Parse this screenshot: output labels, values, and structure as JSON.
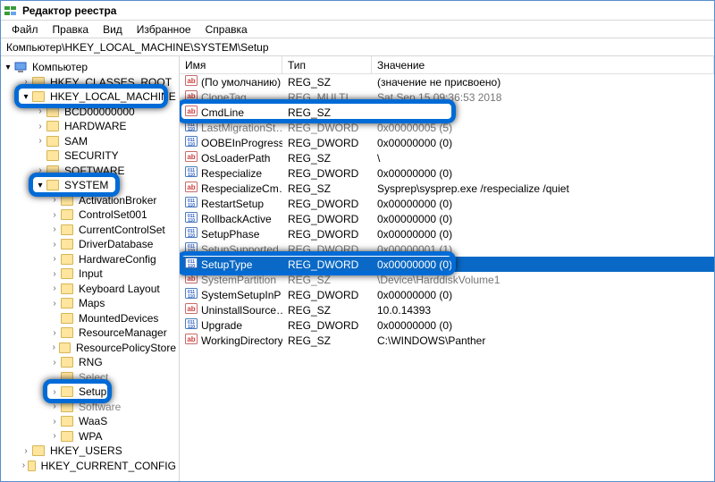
{
  "title": "Редактор реестра",
  "menu": [
    "Файл",
    "Правка",
    "Вид",
    "Избранное",
    "Справка"
  ],
  "path": "Компьютер\\HKEY_LOCAL_MACHINE\\SYSTEM\\Setup",
  "columns": {
    "name": "Имя",
    "type": "Тип",
    "value": "Значение"
  },
  "tree": {
    "root": {
      "label": "Компьютер",
      "kind": "pc",
      "expanded": true
    },
    "nodes": [
      {
        "label": "HKEY_CLASSES_ROOT",
        "depth": 1,
        "exp": "closed"
      },
      {
        "label": "HKEY_LOCAL_MACHINE",
        "depth": 1,
        "exp": "open",
        "hl": true,
        "hl_w": 172,
        "hl_h": 27
      },
      {
        "label": "BCD00000000",
        "depth": 2,
        "exp": "closed"
      },
      {
        "label": "HARDWARE",
        "depth": 2,
        "exp": "closed"
      },
      {
        "label": "SAM",
        "depth": 2,
        "exp": "closed"
      },
      {
        "label": "SECURITY",
        "depth": 2,
        "exp": "none"
      },
      {
        "label": "SOFTWARE",
        "depth": 2,
        "exp": "closed"
      },
      {
        "label": "SYSTEM",
        "depth": 2,
        "exp": "open",
        "hl": true,
        "hl_w": 102,
        "hl_h": 27
      },
      {
        "label": "ActivationBroker",
        "depth": 3,
        "exp": "closed"
      },
      {
        "label": "ControlSet001",
        "depth": 3,
        "exp": "closed"
      },
      {
        "label": "CurrentControlSet",
        "depth": 3,
        "exp": "closed"
      },
      {
        "label": "DriverDatabase",
        "depth": 3,
        "exp": "closed"
      },
      {
        "label": "HardwareConfig",
        "depth": 3,
        "exp": "closed"
      },
      {
        "label": "Input",
        "depth": 3,
        "exp": "closed"
      },
      {
        "label": "Keyboard Layout",
        "depth": 3,
        "exp": "closed"
      },
      {
        "label": "Maps",
        "depth": 3,
        "exp": "closed"
      },
      {
        "label": "MountedDevices",
        "depth": 3,
        "exp": "none"
      },
      {
        "label": "ResourceManager",
        "depth": 3,
        "exp": "closed"
      },
      {
        "label": "ResourcePolicyStore",
        "depth": 3,
        "exp": "closed"
      },
      {
        "label": "RNG",
        "depth": 3,
        "exp": "closed"
      },
      {
        "label": "Select",
        "depth": 3,
        "exp": "none",
        "obscured": true
      },
      {
        "label": "Setup",
        "depth": 3,
        "exp": "closed",
        "hl": true,
        "hl_w": 77,
        "hl_h": 27
      },
      {
        "label": "Software",
        "depth": 3,
        "exp": "closed",
        "obscured": true
      },
      {
        "label": "WaaS",
        "depth": 3,
        "exp": "closed"
      },
      {
        "label": "WPA",
        "depth": 3,
        "exp": "closed"
      },
      {
        "label": "HKEY_USERS",
        "depth": 1,
        "exp": "closed"
      },
      {
        "label": "HKEY_CURRENT_CONFIG",
        "depth": 1,
        "exp": "closed"
      }
    ]
  },
  "rows": [
    {
      "name": "(По умолчанию)",
      "type": "REG_SZ",
      "value": "(значение не присвоено)",
      "icon": "str"
    },
    {
      "name": "CloneTag",
      "type": "REG_MULTI_SZ",
      "value": "Sat Sep 15 09:36:53 2018",
      "icon": "str",
      "obscured": true
    },
    {
      "name": "CmdLine",
      "type": "REG_SZ",
      "value": "",
      "icon": "str",
      "hl": true
    },
    {
      "name": "LastMigrationSt…",
      "type": "REG_DWORD",
      "value": "0x00000005 (5)",
      "icon": "bin",
      "obscured": true
    },
    {
      "name": "OOBEInProgress",
      "type": "REG_DWORD",
      "value": "0x00000000 (0)",
      "icon": "bin"
    },
    {
      "name": "OsLoaderPath",
      "type": "REG_SZ",
      "value": "\\",
      "icon": "str"
    },
    {
      "name": "Respecialize",
      "type": "REG_DWORD",
      "value": "0x00000000 (0)",
      "icon": "bin"
    },
    {
      "name": "RespecializeCm…",
      "type": "REG_SZ",
      "value": "Sysprep\\sysprep.exe /respecialize /quiet",
      "icon": "str"
    },
    {
      "name": "RestartSetup",
      "type": "REG_DWORD",
      "value": "0x00000000 (0)",
      "icon": "bin"
    },
    {
      "name": "RollbackActive",
      "type": "REG_DWORD",
      "value": "0x00000000 (0)",
      "icon": "bin"
    },
    {
      "name": "SetupPhase",
      "type": "REG_DWORD",
      "value": "0x00000000 (0)",
      "icon": "bin"
    },
    {
      "name": "SetupSupported",
      "type": "REG_DWORD",
      "value": "0x00000001 (1)",
      "icon": "bin",
      "obscured": true
    },
    {
      "name": "SetupType",
      "type": "REG_DWORD",
      "value": "0x00000000 (0)",
      "icon": "bin",
      "hl": true,
      "selected": true
    },
    {
      "name": "SystemPartition",
      "type": "REG_SZ",
      "value": "\\Device\\HarddiskVolume1",
      "icon": "str",
      "obscured": true
    },
    {
      "name": "SystemSetupInP…",
      "type": "REG_DWORD",
      "value": "0x00000000 (0)",
      "icon": "bin"
    },
    {
      "name": "UninstallSource…",
      "type": "REG_SZ",
      "value": "10.0.14393",
      "icon": "str"
    },
    {
      "name": "Upgrade",
      "type": "REG_DWORD",
      "value": "0x00000000 (0)",
      "icon": "bin"
    },
    {
      "name": "WorkingDirectory",
      "type": "REG_SZ",
      "value": "C:\\WINDOWS\\Panther",
      "icon": "str"
    }
  ]
}
